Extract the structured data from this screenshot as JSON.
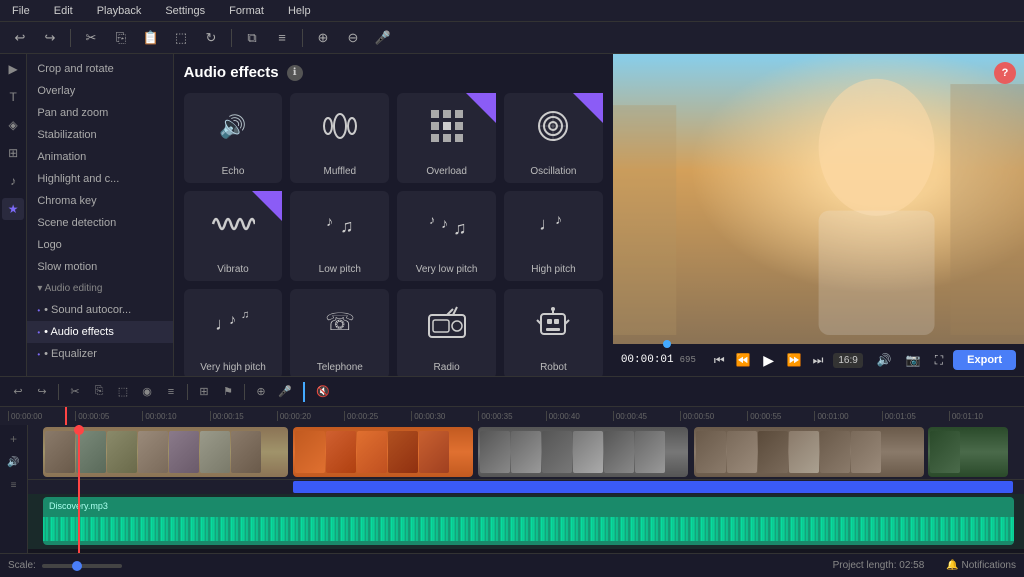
{
  "menu": {
    "items": [
      "File",
      "Edit",
      "Playback",
      "Settings",
      "Format",
      "Help"
    ]
  },
  "toolbar": {
    "undo_label": "↩",
    "redo_label": "↪"
  },
  "sidebar": {
    "items": [
      {
        "label": "Crop and rotate",
        "active": false
      },
      {
        "label": "Overlay",
        "active": false
      },
      {
        "label": "Pan and zoom",
        "active": false
      },
      {
        "label": "Stabilization",
        "active": false
      },
      {
        "label": "Animation",
        "active": false
      },
      {
        "label": "Highlight and c...",
        "active": false
      },
      {
        "label": "Chroma key",
        "active": false
      },
      {
        "label": "Scene detection",
        "active": false
      },
      {
        "label": "Logo",
        "active": false
      },
      {
        "label": "Slow motion",
        "active": false
      },
      {
        "label": "▾ Audio editing",
        "active": false
      },
      {
        "label": "• Sound autocor...",
        "active": false
      },
      {
        "label": "• Audio effects",
        "active": true
      },
      {
        "label": "• Equalizer",
        "active": false
      }
    ]
  },
  "effects_panel": {
    "title": "Audio effects",
    "info_icon": "ℹ",
    "effects": [
      {
        "id": "echo",
        "label": "Echo",
        "icon": "🔊",
        "badge": false
      },
      {
        "id": "muffled",
        "label": "Muffled",
        "icon": "((·))",
        "badge": false
      },
      {
        "id": "overload",
        "label": "Overload",
        "icon": "▦",
        "badge": true
      },
      {
        "id": "oscillation",
        "label": "Oscillation",
        "icon": "◎",
        "badge": true
      },
      {
        "id": "vibrato",
        "label": "Vibrato",
        "icon": "≋",
        "badge": true
      },
      {
        "id": "low-pitch",
        "label": "Low pitch",
        "icon": "𝄽",
        "badge": false
      },
      {
        "id": "very-low-pitch",
        "label": "Very low pitch",
        "icon": "𝄽𝄽",
        "badge": false
      },
      {
        "id": "high-pitch",
        "label": "High pitch",
        "icon": "𝄼",
        "badge": false
      },
      {
        "id": "very-high-pitch",
        "label": "Very high pitch",
        "icon": "𝄼𝄼",
        "badge": false
      },
      {
        "id": "telephone",
        "label": "Telephone",
        "icon": "☏",
        "badge": false
      },
      {
        "id": "radio",
        "label": "Radio",
        "icon": "📻",
        "badge": false
      },
      {
        "id": "robot",
        "label": "Robot",
        "icon": "🤖",
        "badge": false
      }
    ]
  },
  "preview": {
    "time": "00:00:01",
    "frames": "695",
    "ratio": "16:9",
    "export_label": "Export",
    "help_label": "?"
  },
  "timeline": {
    "ruler_marks": [
      "00:00:00",
      "00:00:05",
      "00:00:10",
      "00:00:15",
      "00:00:20",
      "00:00:25",
      "00:00:30",
      "00:00:35",
      "00:00:40",
      "00:00:45",
      "00:00:50",
      "00:00:55",
      "00:01:00",
      "00:01:05",
      "00:01:10"
    ],
    "audio_label": "Discovery.mp3",
    "scale_label": "Scale:",
    "project_length_label": "Project length: 02:58",
    "notifications_label": "🔔 Notifications"
  }
}
